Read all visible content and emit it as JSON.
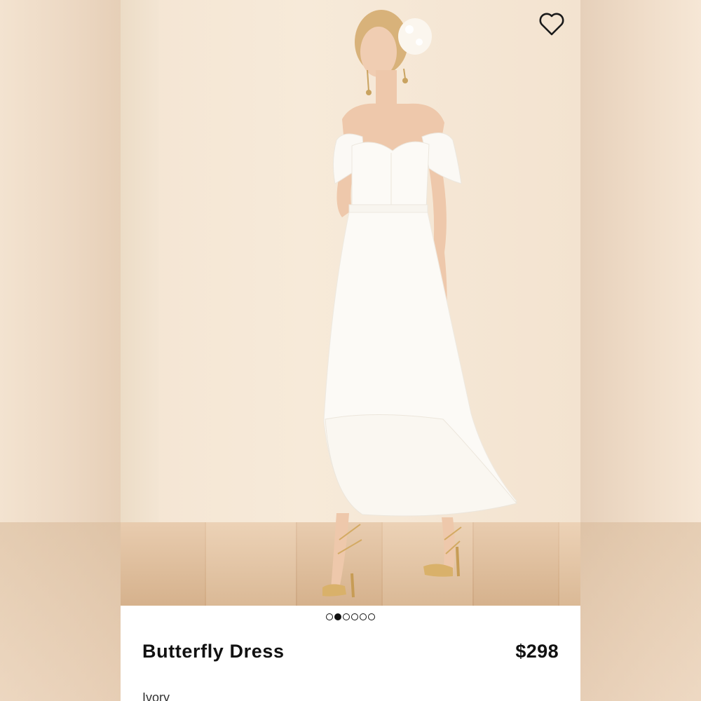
{
  "product": {
    "name": "Butterfly Dress",
    "price": "$298",
    "color": "Ivory"
  },
  "carousel": {
    "total": 6,
    "active_index": 1
  },
  "icons": {
    "favorite": "heart-outline-icon"
  },
  "colors": {
    "background_wall": "#f4e5d3",
    "floor": "#e1bb94",
    "text": "#111111",
    "panel": "#ffffff"
  }
}
